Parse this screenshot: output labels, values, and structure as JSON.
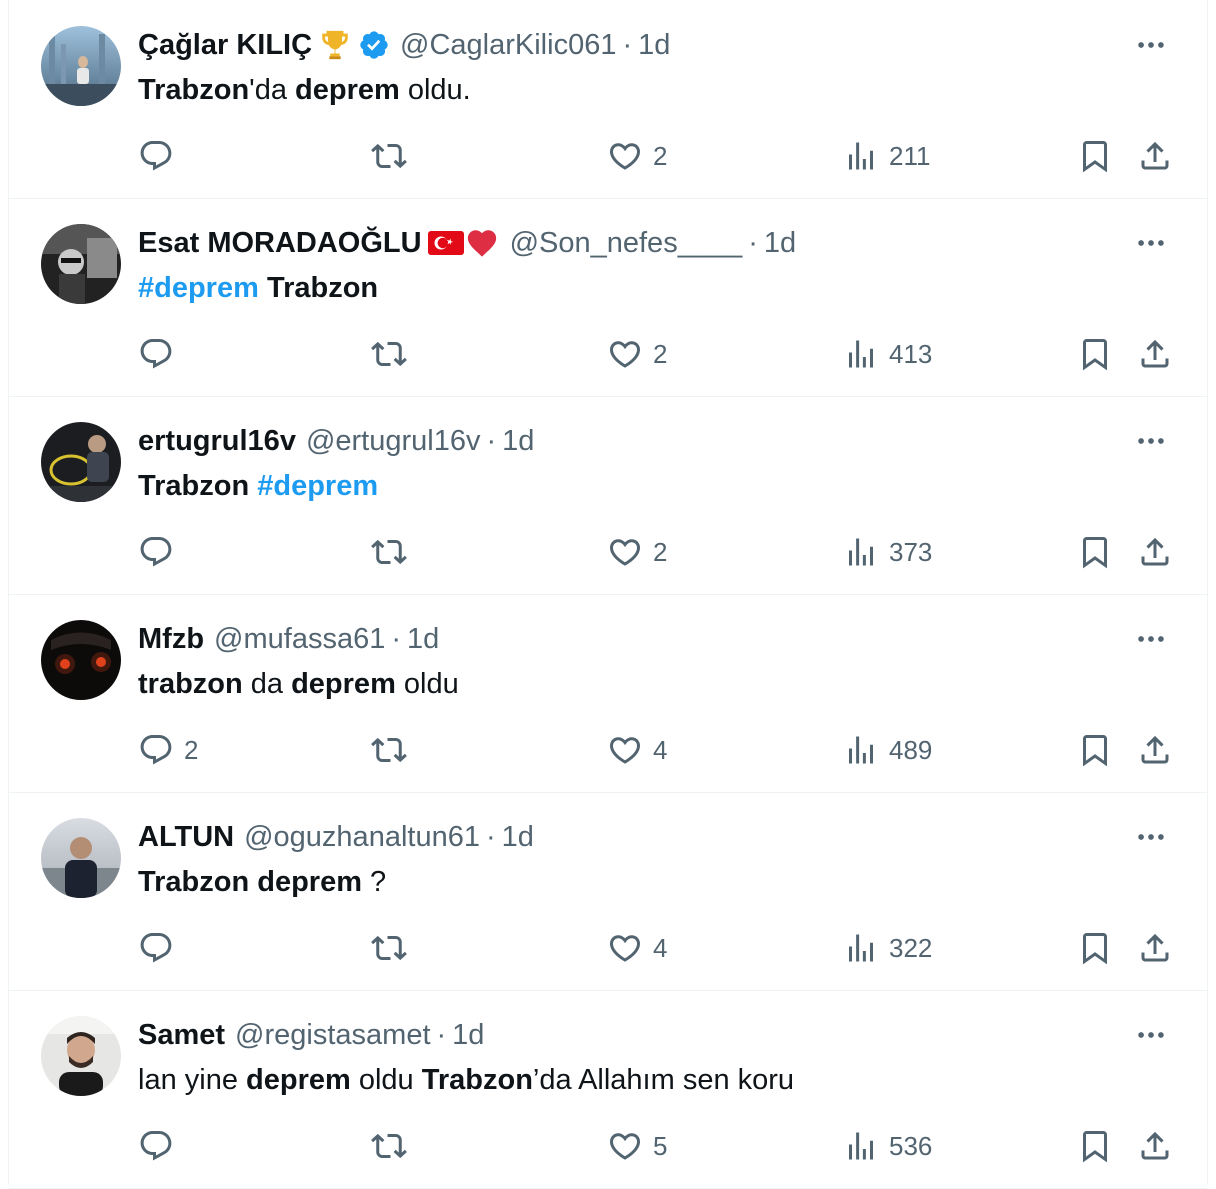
{
  "colors": {
    "accent": "#1d9bf0",
    "text": "#0f1419",
    "muted": "#536471",
    "verified": "#1d9bf0",
    "divider": "#eff3f4"
  },
  "tweets": [
    {
      "name": "Çağlar KILIÇ",
      "badges": [
        "trophy-icon",
        "verified-badge-icon"
      ],
      "handle": "@CaglarKilic061",
      "sep": "·",
      "time": "1d",
      "text": [
        {
          "t": "Trabzon",
          "s": "bold"
        },
        {
          "t": "'da ",
          "s": "normal"
        },
        {
          "t": "deprem",
          "s": "bold"
        },
        {
          "t": " oldu.",
          "s": "normal"
        }
      ],
      "replies": "",
      "retweets": "",
      "likes": "2",
      "views": "211"
    },
    {
      "name": "Esat MORADAOĞLU",
      "badges": [
        "turkish-flag-icon",
        "red-heart-icon"
      ],
      "handle": "@Son_nefes____",
      "sep": "·",
      "time": "1d",
      "text": [
        {
          "t": "#deprem",
          "s": "tag"
        },
        {
          "t": " ",
          "s": "normal"
        },
        {
          "t": "Trabzon",
          "s": "bold"
        }
      ],
      "replies": "",
      "retweets": "",
      "likes": "2",
      "views": "413"
    },
    {
      "name": "ertugrul16v",
      "badges": [],
      "handle": "@ertugrul16v",
      "sep": "·",
      "time": "1d",
      "text": [
        {
          "t": "Trabzon",
          "s": "bold"
        },
        {
          "t": " ",
          "s": "normal"
        },
        {
          "t": "#deprem",
          "s": "tag"
        }
      ],
      "replies": "",
      "retweets": "",
      "likes": "2",
      "views": "373"
    },
    {
      "name": "Mfzb",
      "badges": [],
      "handle": "@mufassa61",
      "sep": "·",
      "time": "1d",
      "text": [
        {
          "t": "trabzon",
          "s": "bold"
        },
        {
          "t": " da ",
          "s": "normal"
        },
        {
          "t": "deprem",
          "s": "bold"
        },
        {
          "t": " oldu",
          "s": "normal"
        }
      ],
      "replies": "2",
      "retweets": "",
      "likes": "4",
      "views": "489"
    },
    {
      "name": "ALTUN",
      "badges": [],
      "handle": "@oguzhanaltun61",
      "sep": "·",
      "time": "1d",
      "text": [
        {
          "t": "Trabzon",
          "s": "bold"
        },
        {
          "t": " ",
          "s": "normal"
        },
        {
          "t": "deprem",
          "s": "bold"
        },
        {
          "t": " ?",
          "s": "normal"
        }
      ],
      "replies": "",
      "retweets": "",
      "likes": "4",
      "views": "322"
    },
    {
      "name": "Samet",
      "badges": [],
      "handle": "@registasamet",
      "sep": "·",
      "time": "1d",
      "text": [
        {
          "t": "lan yine ",
          "s": "normal"
        },
        {
          "t": "deprem",
          "s": "bold"
        },
        {
          "t": " oldu ",
          "s": "normal"
        },
        {
          "t": "Trabzon",
          "s": "bold"
        },
        {
          "t": "’da Allahım sen koru",
          "s": "normal"
        }
      ],
      "replies": "",
      "retweets": "",
      "likes": "5",
      "views": "536"
    }
  ]
}
